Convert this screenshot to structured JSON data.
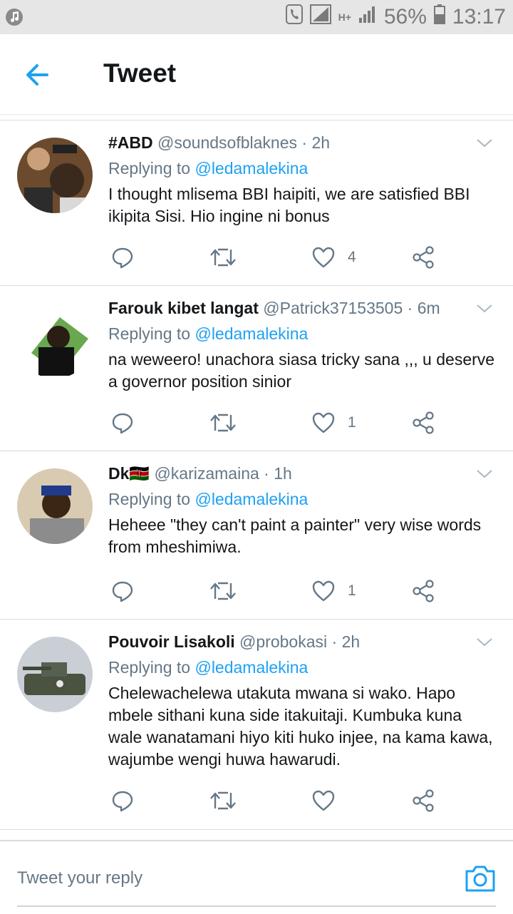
{
  "status_bar": {
    "battery": "56%",
    "time": "13:17",
    "network": "H+"
  },
  "header": {
    "title": "Tweet"
  },
  "tweets": [
    {
      "name": "#ABD",
      "handle": "@soundsofblaknes",
      "time": "· 2h",
      "replying_label": "Replying to",
      "replying_to": "@ledamalekina",
      "text": "I thought mlisema BBI haipiti, we are satisfied BBI ikipita Sisi. Hio ingine ni bonus",
      "likes": "4"
    },
    {
      "name": "Farouk kibet langat",
      "handle": "@Patrick37153505",
      "time": "· 6m",
      "replying_label": "Replying to",
      "replying_to": "@ledamalekina",
      "text": "na weweero! unachora siasa tricky sana ,,, u deserve a governor position sinior",
      "likes": "1"
    },
    {
      "name": "Dk🇰🇪",
      "handle": "@karizamaina",
      "time": "· 1h",
      "replying_label": "Replying to",
      "replying_to": "@ledamalekina",
      "text": "Heheee \"they can't paint a painter\" very wise words from mheshimiwa.",
      "likes": "1"
    },
    {
      "name": "Pouvoir Lisakoli",
      "handle": "@probokasi",
      "time": "· 2h",
      "replying_label": "Replying to",
      "replying_to": "@ledamalekina",
      "text": "Chelewachelewa utakuta mwana si wako. Hapo mbele sithani kuna side itakuitaji. Kumbuka kuna wale wanatamani hiyo kiti huko injee, na kama kawa, wajumbe wengi huwa hawarudi.",
      "likes": ""
    }
  ],
  "composer": {
    "placeholder": "Tweet your reply"
  },
  "colors": {
    "accent": "#1da1f2",
    "secondary_text": "#657786",
    "primary_text": "#14171a"
  },
  "icons": [
    "music-note-icon",
    "call-icon",
    "signal-icon",
    "battery-icon",
    "back-arrow-icon",
    "chevron-down-icon",
    "reply-icon",
    "retweet-icon",
    "like-icon",
    "share-icon",
    "camera-icon"
  ]
}
